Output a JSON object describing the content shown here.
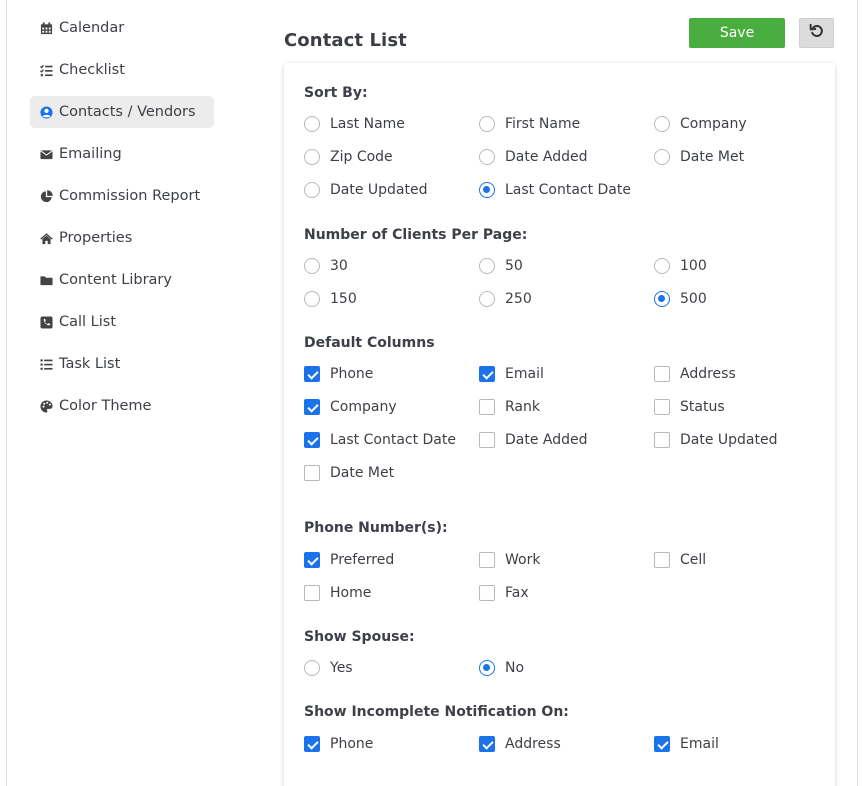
{
  "sidebar": {
    "items": [
      {
        "label": "Calendar",
        "icon": "calendar-icon"
      },
      {
        "label": "Checklist",
        "icon": "checklist-icon"
      },
      {
        "label": "Contacts / Vendors",
        "icon": "user-circle-icon",
        "active": true
      },
      {
        "label": "Emailing",
        "icon": "envelope-icon"
      },
      {
        "label": "Commission Report",
        "icon": "pie-chart-icon"
      },
      {
        "label": "Properties",
        "icon": "home-icon"
      },
      {
        "label": "Content Library",
        "icon": "folder-icon"
      },
      {
        "label": "Call List",
        "icon": "phone-square-icon"
      },
      {
        "label": "Task List",
        "icon": "list-icon"
      },
      {
        "label": "Color Theme",
        "icon": "palette-icon"
      }
    ]
  },
  "header": {
    "title": "Contact List",
    "save_label": "Save",
    "reset_icon": "undo-icon"
  },
  "colors": {
    "accent": "#1a73e8",
    "save": "#4aad3f",
    "active_bg": "#ececec"
  },
  "sort_by": {
    "title": "Sort By:",
    "options": [
      {
        "label": "Last Name",
        "selected": false
      },
      {
        "label": "First Name",
        "selected": false
      },
      {
        "label": "Company",
        "selected": false
      },
      {
        "label": "Zip Code",
        "selected": false
      },
      {
        "label": "Date Added",
        "selected": false
      },
      {
        "label": "Date Met",
        "selected": false
      },
      {
        "label": "Date Updated",
        "selected": false
      },
      {
        "label": "Last Contact Date",
        "selected": true
      }
    ]
  },
  "per_page": {
    "title": "Number of Clients Per Page:",
    "options": [
      {
        "label": "30",
        "selected": false
      },
      {
        "label": "50",
        "selected": false
      },
      {
        "label": "100",
        "selected": false
      },
      {
        "label": "150",
        "selected": false
      },
      {
        "label": "250",
        "selected": false
      },
      {
        "label": "500",
        "selected": true
      }
    ]
  },
  "default_columns": {
    "title": "Default Columns",
    "options": [
      {
        "label": "Phone",
        "checked": true
      },
      {
        "label": "Email",
        "checked": true
      },
      {
        "label": "Address",
        "checked": false
      },
      {
        "label": "Company",
        "checked": true
      },
      {
        "label": "Rank",
        "checked": false
      },
      {
        "label": "Status",
        "checked": false
      },
      {
        "label": "Last Contact Date",
        "checked": true
      },
      {
        "label": "Date Added",
        "checked": false
      },
      {
        "label": "Date Updated",
        "checked": false
      },
      {
        "label": "Date Met",
        "checked": false
      }
    ]
  },
  "phone_numbers": {
    "title": "Phone Number(s):",
    "options": [
      {
        "label": "Preferred",
        "checked": true
      },
      {
        "label": "Work",
        "checked": false
      },
      {
        "label": "Cell",
        "checked": false
      },
      {
        "label": "Home",
        "checked": false
      },
      {
        "label": "Fax",
        "checked": false
      }
    ]
  },
  "show_spouse": {
    "title": "Show Spouse:",
    "options": [
      {
        "label": "Yes",
        "selected": false
      },
      {
        "label": "No",
        "selected": true
      }
    ]
  },
  "incomplete_notification": {
    "title": "Show Incomplete Notification On:",
    "options": [
      {
        "label": "Phone",
        "checked": true
      },
      {
        "label": "Address",
        "checked": true
      },
      {
        "label": "Email",
        "checked": true
      }
    ]
  }
}
